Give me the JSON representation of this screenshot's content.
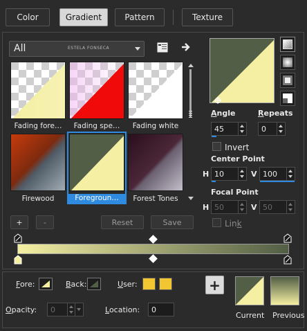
{
  "tabs": [
    {
      "label": "Color",
      "active": false
    },
    {
      "label": "Gradient",
      "active": true
    },
    {
      "label": "Pattern",
      "active": false
    },
    {
      "label": "Texture",
      "active": false
    }
  ],
  "category": {
    "value": "All",
    "watermark": "ESTELA FONSECA"
  },
  "gradients": [
    {
      "label": "Fading fore…"
    },
    {
      "label": "Fading spe…"
    },
    {
      "label": "Fading white"
    },
    {
      "label": "Firewood"
    },
    {
      "label": "Foregroun…",
      "selected": true
    },
    {
      "label": "Forest Tones"
    }
  ],
  "preset_buttons": {
    "add": "+",
    "remove": "-",
    "reset": "Reset",
    "save": "Save"
  },
  "angle": {
    "label": "Angle",
    "value": "45"
  },
  "repeats": {
    "label": "Repeats",
    "value": "0"
  },
  "invert": {
    "label": "Invert",
    "checked": false
  },
  "center_point": {
    "label": "Center Point",
    "h_label": "H",
    "h_value": "10",
    "v_label": "V",
    "v_value": "100"
  },
  "focal_point": {
    "label": "Focal Point",
    "h_label": "H",
    "h_value": "50",
    "v_label": "V",
    "v_value": "50"
  },
  "link": {
    "label": "Link",
    "checked": false
  },
  "bottom": {
    "fore_label": "Fore:",
    "back_label": "Back:",
    "user_label": "User:",
    "opacity_label": "Opacity:",
    "opacity_value": "0",
    "location_label": "Location:",
    "location_value": "0",
    "add_label": "+",
    "current_label": "Current",
    "previous_label": "Previous"
  },
  "colors": {
    "olive": "#525e45",
    "cream": "#f4efa2",
    "gold": "#f2c632",
    "accent": "#2f8be0"
  }
}
